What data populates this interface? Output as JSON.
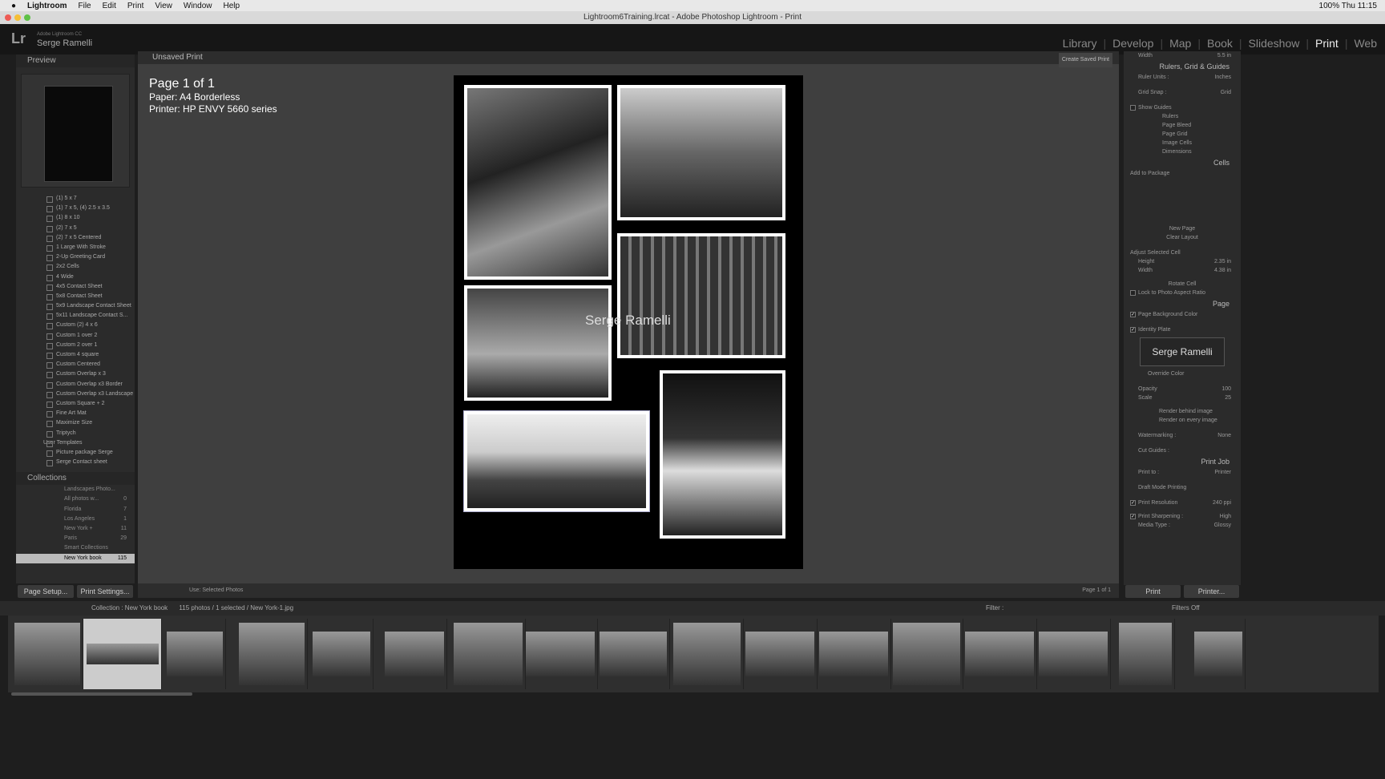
{
  "menubar": {
    "apple": "",
    "app": "Lightroom",
    "items": [
      "File",
      "Edit",
      "Print",
      "View",
      "Window",
      "Help"
    ],
    "status": "100%  Thu 11:15"
  },
  "window": {
    "title": "Lightroom6Training.lrcat - Adobe Photoshop Lightroom - Print"
  },
  "identity": {
    "logo": "Lr",
    "product": "Adobe Lightroom CC",
    "user": "Serge Ramelli"
  },
  "modules": [
    "Library",
    "Develop",
    "Map",
    "Book",
    "Slideshow",
    "Print",
    "Web"
  ],
  "active_module": "Print",
  "left": {
    "preview_label": "Preview",
    "templates": [
      "(1) 5 x 7",
      "(1) 7 x 5, (4) 2.5 x 3.5",
      "(1) 8 x 10",
      "(2) 7 x 5",
      "(2) 7 x 5 Centered",
      "1 Large With Stroke",
      "2-Up Greeting Card",
      "2x2 Cells",
      "4 Wide",
      "4x5 Contact Sheet",
      "5x8 Contact Sheet",
      "5x9 Landscape Contact Sheet",
      "5x11 Landscape Contact S...",
      "Custom (2) 4 x 6",
      "Custom 1 over 2",
      "Custom 2 over 1",
      "Custom 4 square",
      "Custom Centered",
      "Custom Overlap x 3",
      "Custom Overlap x3 Border",
      "Custom Overlap x3 Landscape",
      "Custom Square + 2",
      "Fine Art Mat",
      "Maximize Size",
      "Triptych"
    ],
    "user_templates_label": "User Templates",
    "user_templates": [
      "Picture package Serge",
      "Serge Contact sheet"
    ],
    "collections_label": "Collections",
    "collections": [
      {
        "name": "Landscapes Photo...",
        "count": ""
      },
      {
        "name": "All photos w...",
        "count": "0"
      },
      {
        "name": "Florida",
        "count": "7"
      },
      {
        "name": "Los Angeles",
        "count": "1"
      },
      {
        "name": "New York +",
        "count": "11"
      },
      {
        "name": "Paris",
        "count": "29"
      },
      {
        "name": "Smart Collections",
        "count": ""
      },
      {
        "name": "New York book",
        "count": "115"
      }
    ],
    "page_setup": "Page Setup...",
    "print_settings": "Print Settings..."
  },
  "center": {
    "header": "Unsaved Print",
    "create_saved": "Create Saved Print",
    "page_info": "Page 1 of 1",
    "paper": "Paper:  A4 Borderless",
    "printer": "Printer:  HP ENVY 5660 series",
    "identity_plate": "Serge Ramelli",
    "use_label": "Use:",
    "use_value": "Selected Photos",
    "page_count": "Page 1 of 1"
  },
  "right": {
    "width_label": "Width",
    "width_val": "5.5 in",
    "rulers_section": "Rulers, Grid & Guides",
    "ruler_units": "Ruler Units :",
    "ruler_units_val": "Inches",
    "grid_snap": "Grid Snap :",
    "grid_snap_val": "Grid",
    "show_guides": "Show Guides",
    "guides": [
      "Rulers",
      "Page Bleed",
      "Page Grid",
      "Image Cells",
      "Dimensions"
    ],
    "cells_section": "Cells",
    "add_to_package": "Add to Package",
    "new_page": "New Page",
    "clear_layout": "Clear Layout",
    "adjust_cell": "Adjust Selected Cell",
    "height_label": "Height",
    "height_val": "2.35 in",
    "width2_label": "Width",
    "width2_val": "4.38 in",
    "rotate_cell": "Rotate Cell",
    "lock_aspect": "Lock to Photo Aspect Ratio",
    "page_section": "Page",
    "page_bg": "Page Background Color",
    "identity_plate": "Identity Plate",
    "plate_text": "Serge Ramelli",
    "override_color": "Override Color",
    "opacity": "Opacity",
    "opacity_val": "100",
    "scale": "Scale",
    "scale_val": "25",
    "render_behind": "Render behind image",
    "render_every": "Render on every image",
    "watermarking": "Watermarking :",
    "watermark_val": "None",
    "cut_guides": "Cut Guides :",
    "print_job_section": "Print Job",
    "print_to": "Print to :",
    "print_to_val": "Printer",
    "draft": "Draft Mode Printing",
    "print_res": "Print Resolution",
    "print_res_val": "240 ppi",
    "print_sharp": "Print Sharpening :",
    "print_sharp_val": "High",
    "media_type": "Media Type :",
    "media_val": "Glossy",
    "print_btn": "Print",
    "printer_btn": "Printer..."
  },
  "filmstrip": {
    "collection": "Collection : New York book",
    "count": "115 photos / 1 selected / New York-1.jpg",
    "filter": "Filter :",
    "filters_off": "Filters Off"
  }
}
